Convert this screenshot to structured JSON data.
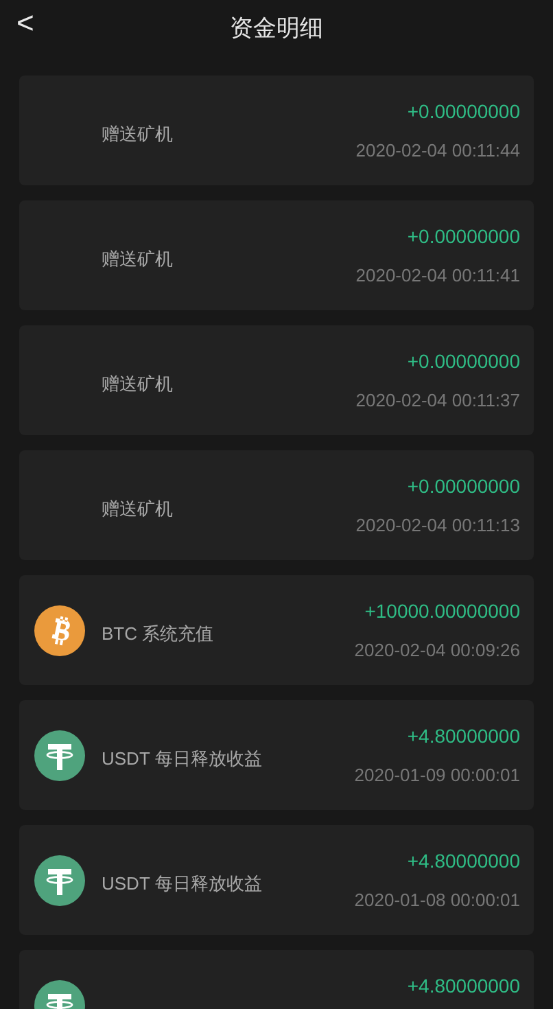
{
  "header": {
    "back_icon": "<",
    "title": "资金明细"
  },
  "records": [
    {
      "kind": "blank",
      "title": "赠送矿机",
      "amount": "+0.00000000",
      "time": "2020-02-04 00:11:44"
    },
    {
      "kind": "blank",
      "title": "赠送矿机",
      "amount": "+0.00000000",
      "time": "2020-02-04 00:11:41"
    },
    {
      "kind": "blank",
      "title": "赠送矿机",
      "amount": "+0.00000000",
      "time": "2020-02-04 00:11:37"
    },
    {
      "kind": "blank",
      "title": "赠送矿机",
      "amount": "+0.00000000",
      "time": "2020-02-04 00:11:13"
    },
    {
      "kind": "btc",
      "title": "BTC 系统充值",
      "amount": "+10000.00000000",
      "time": "2020-02-04 00:09:26"
    },
    {
      "kind": "usdt",
      "title": "USDT 每日释放收益",
      "amount": "+4.80000000",
      "time": "2020-01-09 00:00:01"
    },
    {
      "kind": "usdt",
      "title": "USDT 每日释放收益",
      "amount": "+4.80000000",
      "time": "2020-01-08 00:00:01"
    },
    {
      "kind": "usdt",
      "amount": "+4.80000000"
    }
  ]
}
